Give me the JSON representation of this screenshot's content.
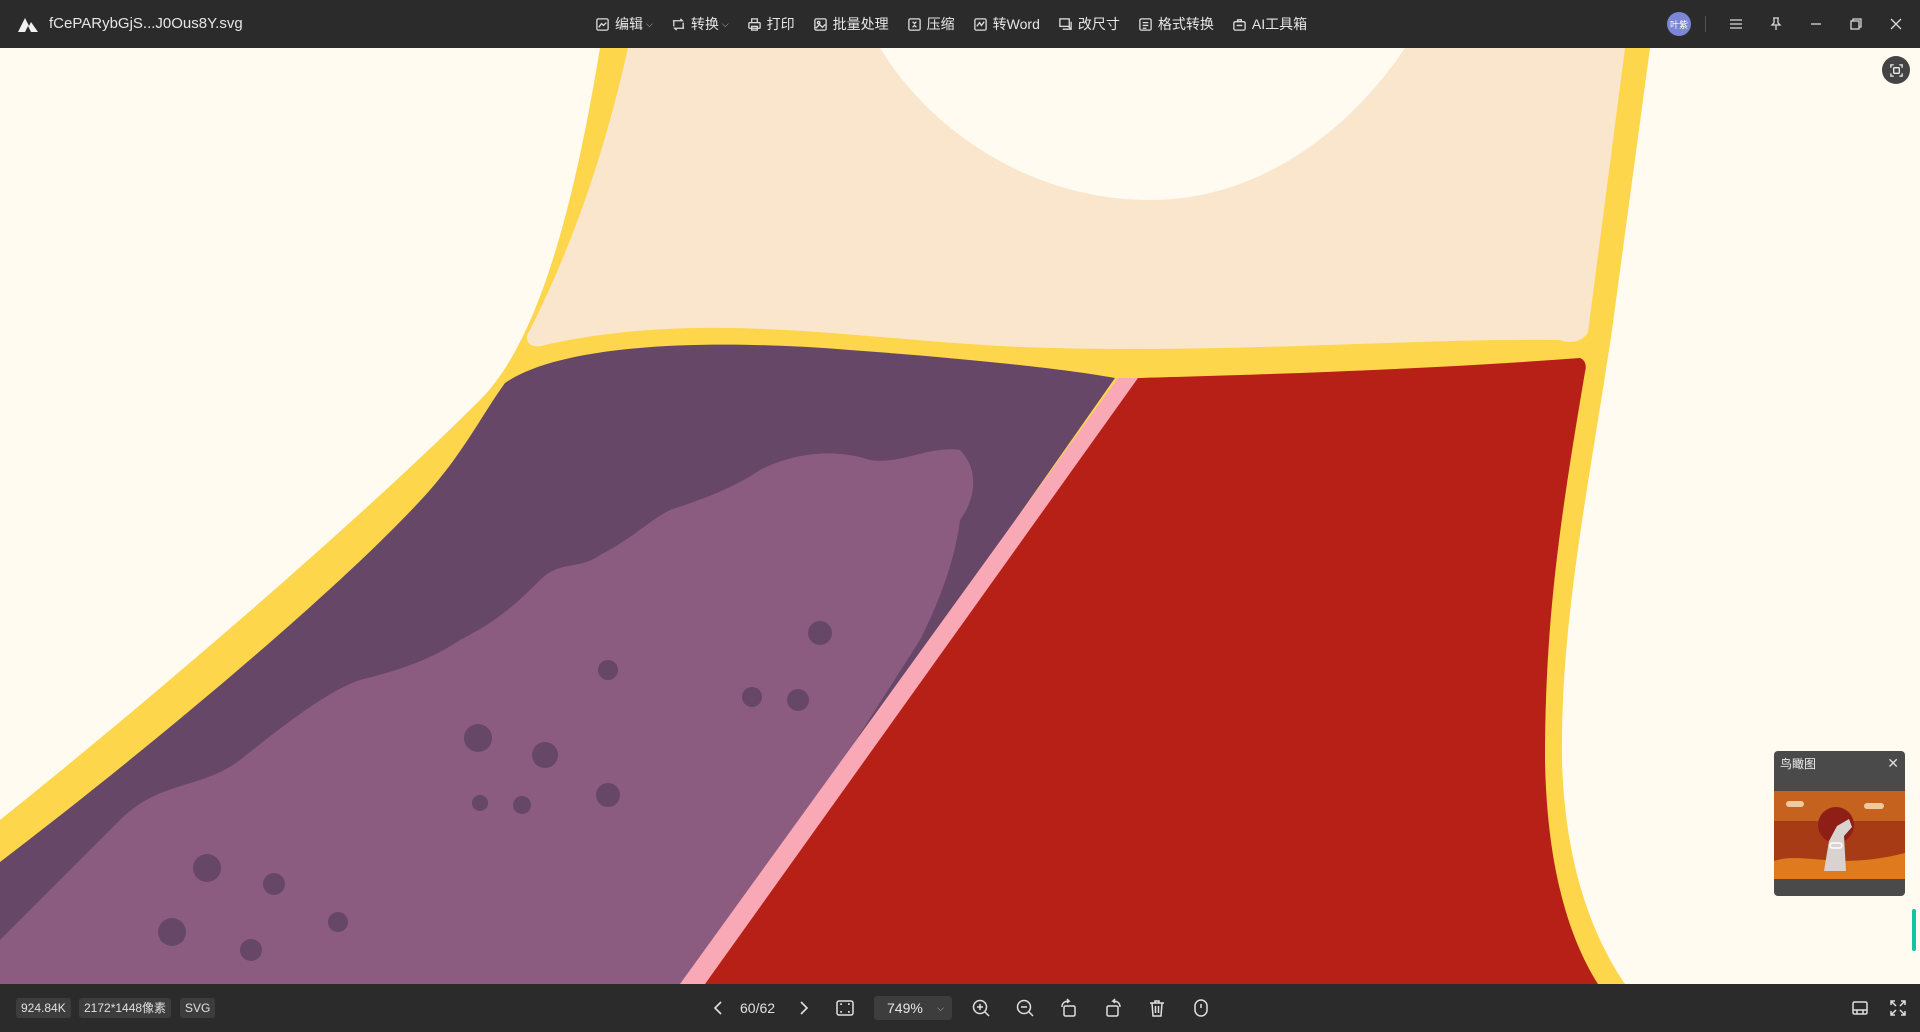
{
  "app": {
    "filename": "fCePARybGjS...J0Ous8Y.svg"
  },
  "menu": [
    {
      "label": "编辑",
      "icon": "image-edit-icon",
      "has_dropdown": true
    },
    {
      "label": "转换",
      "icon": "convert-icon",
      "has_dropdown": true
    },
    {
      "label": "打印",
      "icon": "printer-icon",
      "has_dropdown": false
    },
    {
      "label": "批量处理",
      "icon": "batch-icon",
      "has_dropdown": false
    },
    {
      "label": "压缩",
      "icon": "compress-icon",
      "has_dropdown": false
    },
    {
      "label": "转Word",
      "icon": "word-icon",
      "has_dropdown": false
    },
    {
      "label": "改尺寸",
      "icon": "resize-icon",
      "has_dropdown": false
    },
    {
      "label": "格式转换",
      "icon": "format-icon",
      "has_dropdown": false
    },
    {
      "label": "AI工具箱",
      "icon": "ai-toolbox-icon",
      "has_dropdown": false
    }
  ],
  "user": {
    "avatar_text": "叶紫"
  },
  "minimap": {
    "title": "鸟瞰图"
  },
  "status": {
    "file_size": "924.84K",
    "dimensions": "2172*1448像素",
    "format": "SVG",
    "page": "60/62",
    "zoom": "749%"
  },
  "colors": {
    "background": "#fffbf0",
    "outline_yellow": "#fdd64c",
    "skin": "#fae6cc",
    "purple_dark": "#664767",
    "purple_light": "#8b5c7f",
    "red": "#b72017",
    "pink": "#f9a8b6",
    "chrome": "#2b2b2b"
  }
}
